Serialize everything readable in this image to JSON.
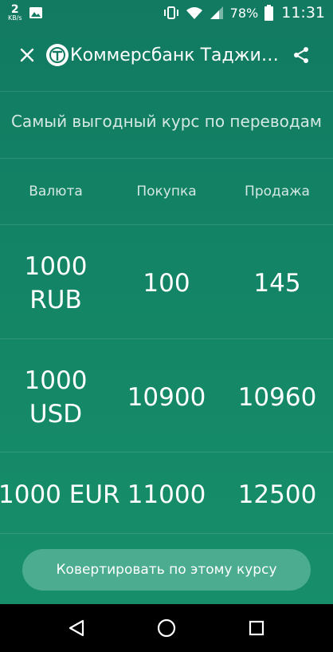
{
  "status_bar": {
    "net_speed_value": "2",
    "net_speed_unit": "KB/s",
    "battery_percent": "78%",
    "time": "11:31",
    "icons": [
      "image-icon",
      "vibrate-icon",
      "wifi-icon",
      "signal-icon",
      "battery-icon"
    ]
  },
  "toolbar": {
    "title": "Коммерсбанк Таджикистана",
    "close_icon": "close-icon",
    "share_icon": "share-icon",
    "logo_icon": "bank-logo-icon"
  },
  "main": {
    "subtitle": "Самый выгодный курс по переводам",
    "columns": [
      "Валюта",
      "Покупка",
      "Продажа"
    ],
    "rows": [
      {
        "currency_line1": "1000",
        "currency_line2": "RUB",
        "buy": "100",
        "sell": "145"
      },
      {
        "currency_line1": "1000",
        "currency_line2": "USD",
        "buy": "10900",
        "sell": "10960"
      },
      {
        "currency": "1000 EUR",
        "buy": "11000",
        "sell": "12500"
      }
    ],
    "convert_button": "Ковертировать по этому курсу"
  },
  "nav_bar": {
    "icons": [
      "back-icon",
      "home-icon",
      "recents-icon"
    ]
  },
  "colors": {
    "background": "#127a61",
    "button": "#4bac8f",
    "nav_bar": "#000000",
    "text": "#ffffff"
  }
}
